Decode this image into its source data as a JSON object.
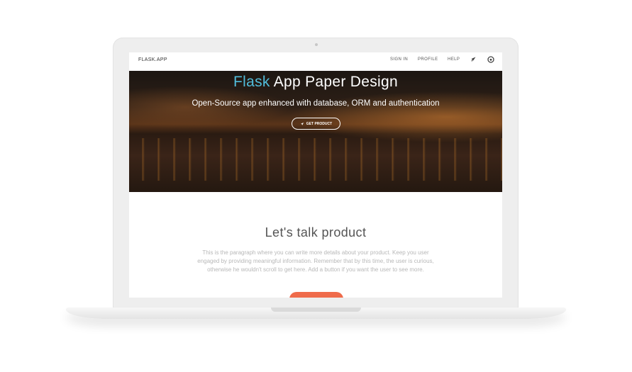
{
  "navbar": {
    "brand": "FLASK.APP",
    "links": [
      "SIGN IN",
      "PROFILE",
      "HELP"
    ],
    "icons": [
      "rocket-icon",
      "github-icon"
    ]
  },
  "hero": {
    "title_accent": "Flask",
    "title_rest": " App Paper Design",
    "subtitle": "Open-Source app enhanced with database, ORM and authentication",
    "button_label": "GET PRODUCT",
    "button_icon": "rocket-icon"
  },
  "section": {
    "title": "Let's talk product",
    "text": "This is the paragraph where you can write more details about your product. Keep you user engaged by providing meaningful information. Remember that by this time, the user is curious, otherwise he wouldn't scroll to get here. Add a button if you want the user to see more."
  },
  "colors": {
    "accent": "#51bcda",
    "cta": "#ef6b4b"
  }
}
